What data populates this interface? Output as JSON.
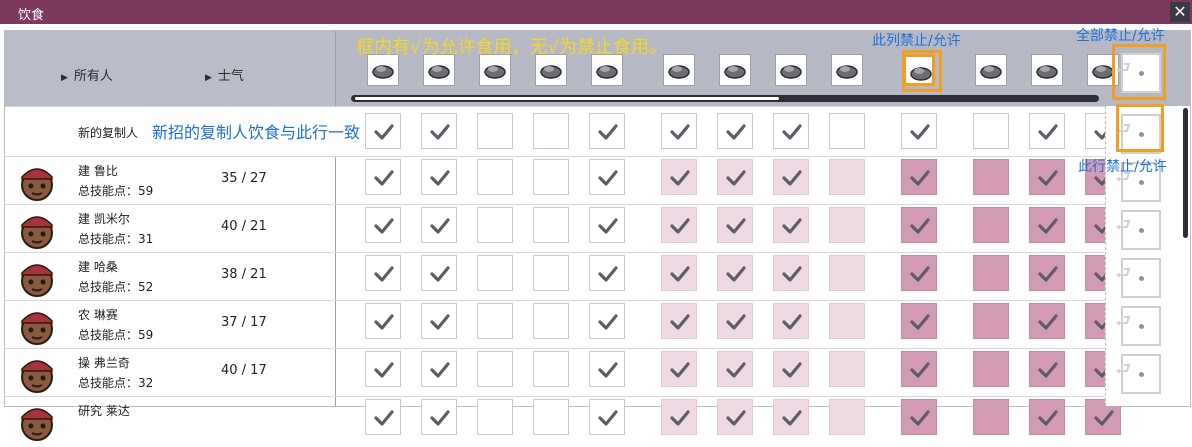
{
  "window": {
    "title": "饮食",
    "close_glyph": "✕"
  },
  "header": {
    "sort_name": "所有人",
    "sort_morale": "士气",
    "sort_arrow": "▶",
    "food_icons": [
      "meal-lice-icon",
      "mush-bar-icon",
      "gristle-berry-icon",
      "roast-icon",
      "pepper-bread-icon",
      "bristle-berry-icon",
      "frost-bun-icon",
      "pickled-meal-icon",
      "cooked-meat-icon",
      "stuffed-berry-icon",
      "grubfruit-icon",
      "barbeque-icon",
      "cooked-seafood-icon"
    ]
  },
  "default_row": {
    "label": "新的复制人"
  },
  "dupes": [
    {
      "name": "建 鲁比",
      "skill": "总技能点：59",
      "morale": "35 / 27"
    },
    {
      "name": "建 凯米尔",
      "skill": "总技能点：31",
      "morale": "40 / 21"
    },
    {
      "name": "建 哈桑",
      "skill": "总技能点：52",
      "morale": "38 / 21"
    },
    {
      "name": "农 琳赛",
      "skill": "总技能点：59",
      "morale": "37 / 17"
    },
    {
      "name": "操 弗兰奇",
      "skill": "总技能点：32",
      "morale": "40 / 17"
    },
    {
      "name": "研究 莱达",
      "skill": "",
      "morale": ""
    }
  ],
  "default_states": [
    "c",
    "c",
    "w",
    "w",
    "c",
    "c",
    "c",
    "c",
    "w",
    "c",
    "w",
    "c",
    "c"
  ],
  "dupe_states": [
    "c",
    "c",
    "w",
    "w",
    "c",
    "pc",
    "pc",
    "pc",
    "p",
    "dc",
    "d",
    "dc",
    "dc"
  ],
  "annotations": {
    "yellow": "框内有√为允许食用，无√为禁止食用。",
    "column": "此列禁止/允许",
    "all": "全部禁止/允许",
    "default_row": "新招的复制人饮食与此行一致",
    "row": "此行禁止/允许"
  },
  "colors": {
    "titlebar": "#7b3a5e",
    "header": "#b6b8c3",
    "pink_light": "#efd9e3",
    "pink_dark": "#d49bb5",
    "highlight": "#f0a020",
    "annot_yellow": "#f2d62a",
    "annot_blue": "#1e6fd9"
  }
}
